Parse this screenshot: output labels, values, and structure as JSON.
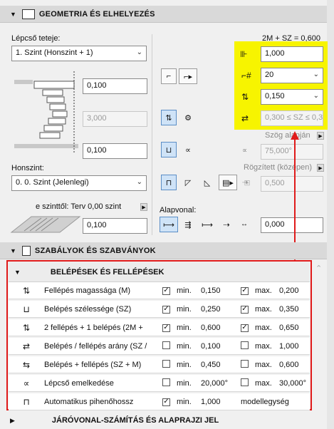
{
  "panel1": {
    "title": "GEOMETRIA ÉS ELHELYEZÉS",
    "top_label": "Lépcső teteje:",
    "top_select": "1. Szint (Honszint + 1)",
    "formula": "2M + SZ = 0,600",
    "offset_top": "0,100",
    "height": "3,000",
    "offset_bottom": "0,100",
    "home_label": "Honszint:",
    "home_select": "0. 0. Szint (Jelenlegi)",
    "plan_label": "e szinttől: Terv 0,00 szint",
    "plan_value": "0,100",
    "width_value": "1,000",
    "risers_value": "20",
    "riser_height": "0,150",
    "tread_range": "0,300 ≤ SZ ≤ 0,3",
    "angle_mode": "Szög alapján",
    "angle_value": "75,000°",
    "fixed_mode": "Rögzített (középen)",
    "fixed_value": "0,500",
    "baseline_label": "Alapvonal:",
    "baseline_value": "0,000"
  },
  "panel2": {
    "title": "SZABÁLYOK ÉS SZABVÁNYOK",
    "sub_title": "BELÉPÉSEK ÉS FELLÉPÉSEK",
    "rows": [
      {
        "label": "Fellépés magassága (M)",
        "min_checked": "✓",
        "min_label": "min.",
        "min_val": "0,150",
        "max_checked": "✓",
        "max_label": "max.",
        "max_val": "0,200"
      },
      {
        "label": "Belépés szélessége (SZ)",
        "min_checked": "✓",
        "min_label": "min.",
        "min_val": "0,250",
        "max_checked": "✓",
        "max_label": "max.",
        "max_val": "0,350"
      },
      {
        "label": "2 fellépés + 1 belépés (2M +",
        "min_checked": "✓",
        "min_label": "min.",
        "min_val": "0,600",
        "max_checked": "✓",
        "max_label": "max.",
        "max_val": "0,650"
      },
      {
        "label": "Belépés / fellépés arány (SZ /",
        "min_checked": "",
        "min_label": "min.",
        "min_val": "0,100",
        "max_checked": "",
        "max_label": "max.",
        "max_val": "1,000"
      },
      {
        "label": "Belépés + fellépés (SZ + M)",
        "min_checked": "",
        "min_label": "min.",
        "min_val": "0,450",
        "max_checked": "",
        "max_label": "max.",
        "max_val": "0,600"
      },
      {
        "label": "Lépcső emelkedése",
        "min_checked": "",
        "min_label": "min.",
        "min_val": "20,000°",
        "max_checked": "",
        "max_label": "max.",
        "max_val": "30,000°"
      },
      {
        "label": "Automatikus pihenőhossz",
        "min_checked": "✓",
        "min_label": "min.",
        "min_val": "1,000",
        "max_checked": "",
        "max_label": "",
        "max_val": "modellegység"
      }
    ]
  },
  "panel3": {
    "title": "JÁRÓVONAL-SZÁMÍTÁS ÉS ALAPRAJZI JEL"
  }
}
